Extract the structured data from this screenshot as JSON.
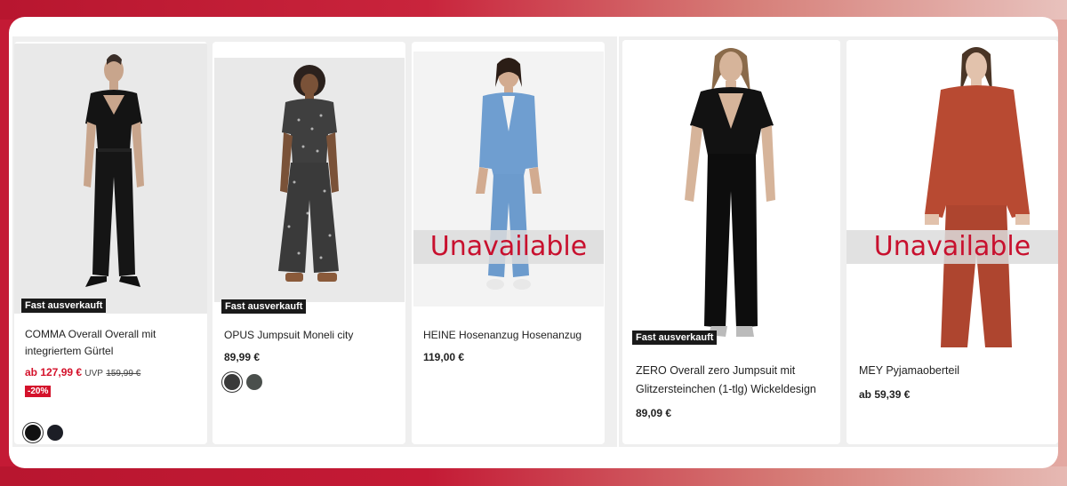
{
  "background_ghost_text": "",
  "products": [
    {
      "brand_title": "COMMA Overall Overall mit integriertem Gürtel",
      "badge": "Fast ausverkauft",
      "price": "ab 127,99 €",
      "uvp_label": "UVP",
      "uvp_value": "159,99 €",
      "discount": "-20%",
      "swatches": [
        "#111111",
        "#1c1e26"
      ],
      "available": true
    },
    {
      "brand_title": "OPUS Jumpsuit Moneli city",
      "badge": "Fast ausverkauft",
      "price": "89,99 €",
      "swatches": [
        "#3a3a3a",
        "#4a4f4c"
      ],
      "available": true
    },
    {
      "brand_title": "HEINE Hosenanzug Hosenanzug",
      "price": "119,00 €",
      "overlay": "Unavailable",
      "available": false
    },
    {
      "brand_title": "ZERO Overall zero Jumpsuit mit Glitzersteinchen (1-tlg) Wickeldesign",
      "badge": "Fast ausverkauft",
      "price": "89,09 €",
      "available": true
    },
    {
      "brand_title": "MEY Pyjamaoberteil",
      "price": "ab 59,39 €",
      "overlay": "Unavailable",
      "available": false
    }
  ],
  "colors": {
    "sale_red": "#d4122b",
    "unavailable_red": "#c8102e",
    "badge_black": "#1a1a1a",
    "brand_bg_red": "#c41a35"
  }
}
